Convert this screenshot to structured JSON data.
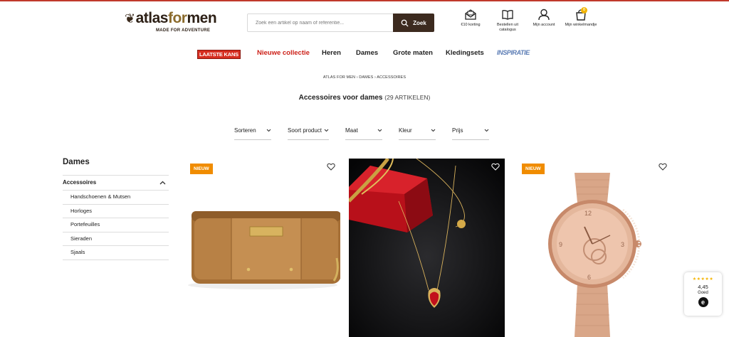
{
  "brand": {
    "name_prefix": "atlas",
    "name_mid": "for",
    "name_suffix": "men",
    "tagline": "MADE FOR ADVENTURE"
  },
  "search": {
    "placeholder": "Zoek een artikel op naam of referentie...",
    "value": "",
    "button_label": "Zoek"
  },
  "header_links": [
    {
      "label": "€10 korting",
      "icon": "envelope-icon"
    },
    {
      "label": "Bestellen uit catalogus",
      "icon": "book-icon"
    },
    {
      "label": "Mijn account",
      "icon": "user-icon"
    },
    {
      "label": "Mijn winkelmandje",
      "icon": "bag-icon",
      "badge": "0"
    }
  ],
  "nav": {
    "items": [
      "LAATSTE KANS",
      "Nieuwe collectie",
      "Heren",
      "Dames",
      "Grote maten",
      "Kledingsets",
      "INSPIRATIE"
    ],
    "accent_red": "#d62d20",
    "accent_blue": "#5a7bb4"
  },
  "breadcrumb": [
    "ATLAS FOR MEN",
    "DAMES",
    "ACCESSOIRES"
  ],
  "page": {
    "title": "Accessoires voor dames",
    "count": "(29 ARTIKELEN)"
  },
  "filters": [
    "Sorteren",
    "Soort product",
    "Maat",
    "Kleur",
    "Prijs"
  ],
  "sidebar": {
    "title": "Dames",
    "section": "Accessoires",
    "items": [
      "Handschoenen & Mutsen",
      "Horloges",
      "Portefeuilles",
      "Sieraden",
      "Sjaals"
    ]
  },
  "products": [
    {
      "badge": "NIEUW",
      "image": "wallet-image",
      "colour": "#b07a3e"
    },
    {
      "badge": "",
      "image": "necklace-image",
      "colour": "#c8a04a"
    },
    {
      "badge": "NIEUW",
      "image": "watch-image",
      "colour": "#d9a07f"
    }
  ],
  "rating": {
    "stars": 5,
    "score": "4,45",
    "label": "Goed"
  },
  "colors": {
    "brand_brown": "#3c2a1f",
    "new_badge": "#f08c00",
    "star": "#f5b400"
  }
}
